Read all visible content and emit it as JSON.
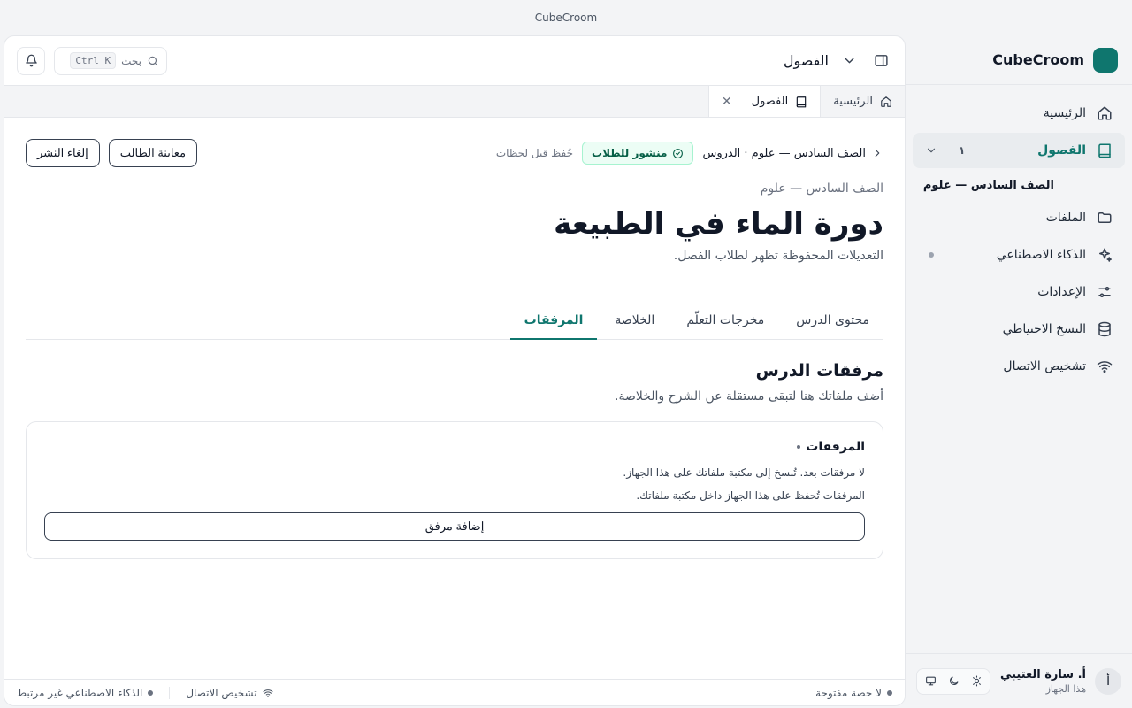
{
  "window": {
    "title": "CubeCroom"
  },
  "sidebar": {
    "brand": "CubeCroom",
    "items": [
      {
        "label": "الرئيسية",
        "icon": "home-icon"
      },
      {
        "label": "الفصول",
        "icon": "book-icon",
        "count": "١",
        "active": true
      },
      {
        "label": "الملفات",
        "icon": "folder-icon"
      },
      {
        "label": "الذكاء الاصطناعي",
        "icon": "sparkles-icon"
      },
      {
        "label": "الإعدادات",
        "icon": "sliders-icon"
      },
      {
        "label": "النسخ الاحتياطي",
        "icon": "database-icon"
      },
      {
        "label": "تشخيص الاتصال",
        "icon": "wifi-icon"
      }
    ],
    "subitem": "الصف السادس — علوم",
    "user": {
      "initial": "أ",
      "name": "أ. سارة العتيبي",
      "device": "هذا الجهاز"
    }
  },
  "topbar": {
    "title": "الفصول",
    "search_placeholder": "بحث",
    "search_shortcut": "Ctrl K"
  },
  "tabs": [
    {
      "label": "الرئيسية",
      "icon": "home-icon"
    },
    {
      "label": "الفصول",
      "icon": "book-icon",
      "closable": true
    }
  ],
  "header": {
    "breadcrumb": "الصف السادس — علوم · الدروس",
    "status_badge": "منشور للطلاب",
    "saved": "حُفظ قبل لحظات",
    "preview_button": "معاينة الطالب",
    "unpublish_button": "إلغاء النشر"
  },
  "lesson": {
    "subject": "الصف السادس — علوم",
    "title": "دورة الماء في الطبيعة",
    "description": "التعديلات المحفوظة تظهر لطلاب الفصل."
  },
  "content_tabs": [
    {
      "label": "محتوى الدرس"
    },
    {
      "label": "مخرجات التعلّم"
    },
    {
      "label": "الخلاصة"
    },
    {
      "label": "المرفقات",
      "active": true
    }
  ],
  "attachments": {
    "section_title": "مرفقات الدرس",
    "section_desc": "أضف ملفاتك هنا لتبقى مستقلة عن الشرح والخلاصة.",
    "card_title": "المرفقات",
    "empty_text": "لا مرفقات بعد. تُنسخ إلى مكتبة ملفاتك على هذا الجهاز.",
    "storage_note": "المرفقات تُحفظ على هذا الجهاز داخل مكتبة ملفاتك.",
    "add_button": "إضافة مرفق"
  },
  "statusbar": {
    "session": "لا حصة مفتوحة",
    "connection": "تشخيص الاتصال",
    "ai": "الذكاء الاصطناعي غير مرتبط"
  },
  "colors": {
    "accent": "#0f766e",
    "badge_bg": "#ecfdf5"
  }
}
